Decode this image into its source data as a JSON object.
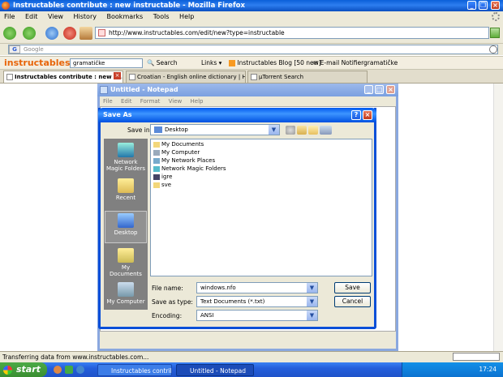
{
  "firefox": {
    "title": "Instructables contribute : new instructable - Mozilla Firefox",
    "menu": [
      "File",
      "Edit",
      "View",
      "History",
      "Bookmarks",
      "Tools",
      "Help"
    ],
    "url": "http://www.instructables.com/edit/new?type=instructable",
    "google_placeholder": "Google",
    "inst_logo": "instructables",
    "inst_search": "gramatičke",
    "inst_items": {
      "search": "Search",
      "links": "Links",
      "blog": "Instructables Blog [50 new]",
      "email": "E-mail Notifier",
      "term": "gramatičke"
    },
    "tabs": [
      {
        "label": "Instructables contribute : new in..."
      },
      {
        "label": "Croatian - English online dictionary | H..."
      },
      {
        "label": "µTorrent Search"
      }
    ],
    "status": "Transferring data from www.instructables.com..."
  },
  "notepad": {
    "title": "Untitled - Notepad",
    "menu": [
      "File",
      "Edit",
      "Format",
      "View",
      "Help"
    ]
  },
  "dialog": {
    "title": "Save As",
    "save_in_label": "Save in:",
    "save_in_value": "Desktop",
    "places": [
      "Network Magic Folders",
      "Recent",
      "Desktop",
      "My Documents",
      "My Computer"
    ],
    "files": [
      "My Documents",
      "My Computer",
      "My Network Places",
      "Network Magic Folders",
      "igre",
      "sve"
    ],
    "file_name_label": "File name:",
    "file_name_value": "windows.nfo",
    "save_type_label": "Save as type:",
    "save_type_value": "Text Documents (*.txt)",
    "encoding_label": "Encoding:",
    "encoding_value": "ANSI",
    "save_button": "Save",
    "cancel_button": "Cancel"
  },
  "taskbar": {
    "start": "start",
    "tasks": [
      "Instructables contrib...",
      "Untitled - Notepad"
    ],
    "clock": "17:24"
  }
}
